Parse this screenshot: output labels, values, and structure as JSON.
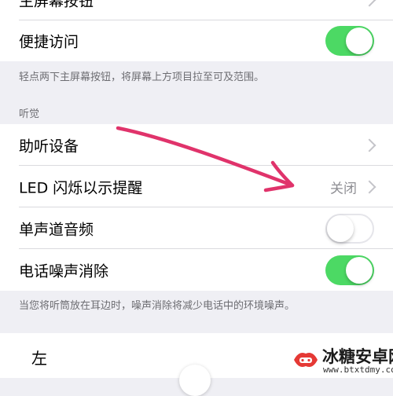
{
  "rows": {
    "home_button": {
      "label": "主屏幕按钮"
    },
    "reachability": {
      "label": "便捷访问",
      "toggle_on": true
    },
    "hearing_devices": {
      "label": "助听设备"
    },
    "led_flash": {
      "label": "LED 闪烁以示提醒",
      "value": "关闭"
    },
    "mono_audio": {
      "label": "单声道音频",
      "toggle_on": false
    },
    "noise_cancel": {
      "label": "电话噪声消除",
      "toggle_on": true
    }
  },
  "notes": {
    "reachability": "轻点两下主屏幕按钮，将屏幕上方项目拉至可及范围。",
    "noise_cancel": "当您将听筒放在耳边时，噪声消除将减少电话中的环境噪声。"
  },
  "sections": {
    "hearing": "听觉"
  },
  "balance": {
    "left_label": "左"
  },
  "watermark": {
    "name": "冰糖安卓网",
    "url": "www.btxtdmy.com"
  },
  "colors": {
    "toggle_on": "#4cd964",
    "annotation_arrow": "#e0336b"
  }
}
